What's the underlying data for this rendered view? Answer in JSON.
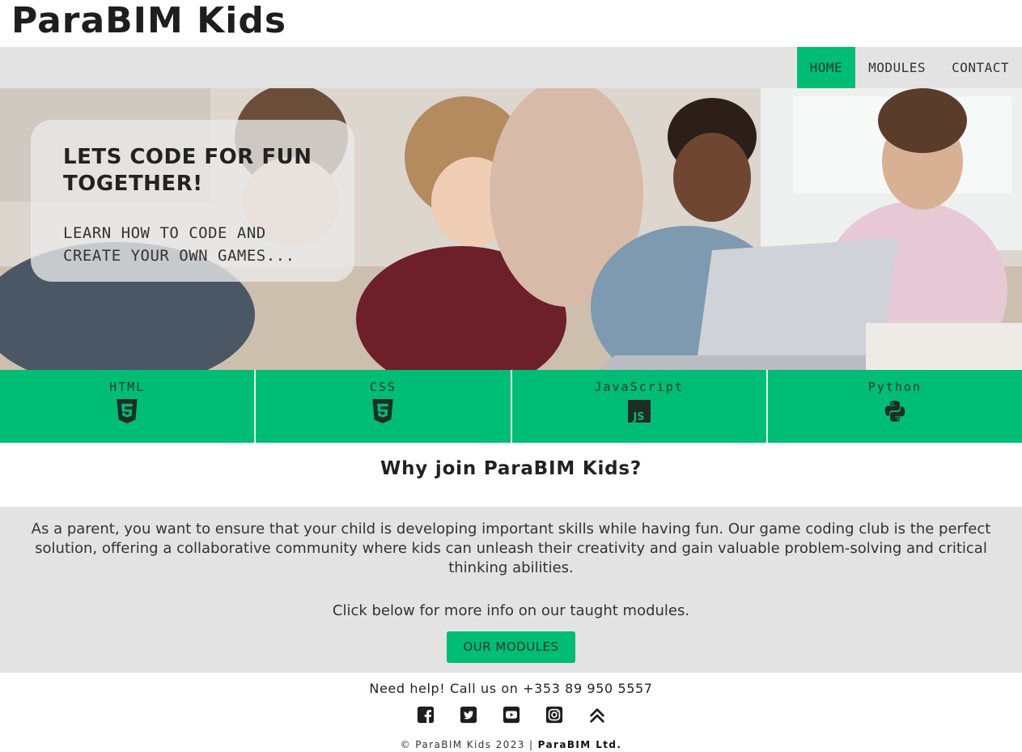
{
  "site": {
    "title": "ParaBIM Kids"
  },
  "nav": {
    "items": [
      {
        "label": "HOME",
        "active": true
      },
      {
        "label": "MODULES",
        "active": false
      },
      {
        "label": "CONTACT",
        "active": false
      }
    ]
  },
  "hero": {
    "title": "LETS CODE FOR FUN TOGETHER!",
    "subtitle": "LEARN HOW TO CODE AND CREATE YOUR OWN GAMES..."
  },
  "languages": [
    {
      "name": "HTML",
      "icon": "html5-icon"
    },
    {
      "name": "CSS",
      "icon": "css3-icon"
    },
    {
      "name": "JavaScript",
      "icon": "js-icon"
    },
    {
      "name": "Python",
      "icon": "python-icon"
    }
  ],
  "why": {
    "title": "Why join ParaBIM Kids?",
    "body": "As a parent, you want to ensure that your child is developing important skills while having fun. Our game coding club is the perfect solution, offering a collaborative community where kids can unleash their creativity and gain valuable problem-solving and critical thinking abilities.",
    "cta_text": "Click below for more info on our taught modules.",
    "button_label": "OUR MODULES"
  },
  "footer": {
    "help": "Need help! Call us on +353 89 950 5557",
    "social_icons": [
      "facebook-icon",
      "twitter-icon",
      "youtube-icon",
      "instagram-icon",
      "back-to-top-icon"
    ],
    "copyright_prefix": "© ParaBIM Kids 2023 | ",
    "copyright_company": "ParaBIM Ltd."
  },
  "colors": {
    "accent": "#00bd75",
    "nav_bg": "#e3e3e3",
    "text_dark": "#222222"
  }
}
